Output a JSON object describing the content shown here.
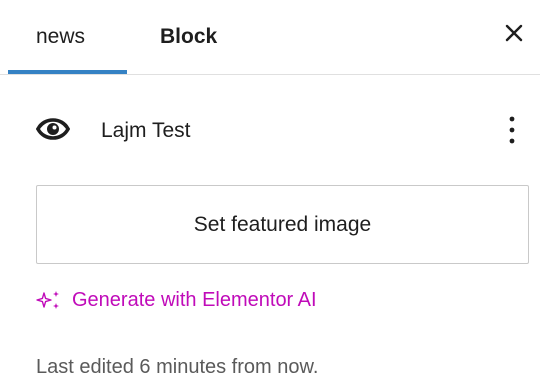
{
  "tabs": [
    {
      "label": "news"
    },
    {
      "label": "Block"
    }
  ],
  "close_label": "✕",
  "post": {
    "type_label": "Lajm Test",
    "more_label": "⋮"
  },
  "featured": {
    "button_label": "Set featured image"
  },
  "ai": {
    "label": "Generate with Elementor AI"
  },
  "status": {
    "last_edited": "Last edited 6 minutes from now."
  },
  "colors": {
    "accent": "#3582c4",
    "ai": "#c00bb9",
    "text": "#1e1e1e",
    "muted": "#5a5a5a",
    "border": "#c9c9c9"
  },
  "icons": {
    "post_type": "eye-icon",
    "close": "close-icon",
    "more": "kebab-menu-icon",
    "ai": "sparkle-icon"
  }
}
